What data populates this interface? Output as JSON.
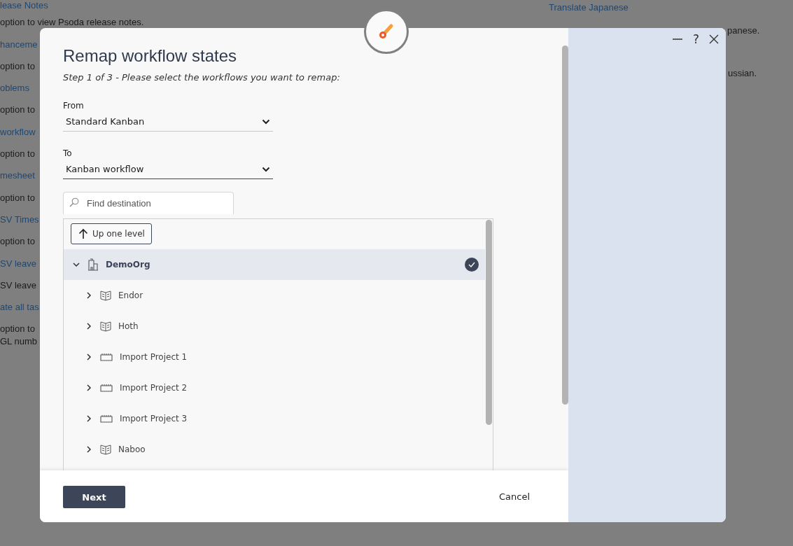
{
  "background": {
    "left_lines": [
      {
        "text": "lease Notes",
        "kind": "link"
      },
      {
        "text": "option to view Psoda release notes.",
        "kind": "text"
      },
      {
        "text": "hanceme",
        "kind": "link"
      },
      {
        "text": "option to",
        "kind": "text"
      },
      {
        "text": "oblems",
        "kind": "link"
      },
      {
        "text": "option to",
        "kind": "text"
      },
      {
        "text": "workflow",
        "kind": "link"
      },
      {
        "text": "option to",
        "kind": "text"
      },
      {
        "text": "mesheet",
        "kind": "link"
      },
      {
        "text": "option to",
        "kind": "text"
      },
      {
        "text": "SV Times",
        "kind": "link"
      },
      {
        "text": "option to",
        "kind": "text"
      },
      {
        "text": "SV leave",
        "kind": "link"
      },
      {
        "text": "SV leave",
        "kind": "text"
      },
      {
        "text": "ate all tas",
        "kind": "link"
      },
      {
        "text": "option to",
        "kind": "text"
      },
      {
        "text": "GL numb",
        "kind": "text"
      }
    ],
    "right_lines": [
      {
        "text": "Translate Japanese",
        "kind": "link"
      },
      {
        "text": "panese.",
        "kind": "text"
      },
      {
        "text": "ussian.",
        "kind": "text"
      }
    ]
  },
  "dialog": {
    "title": "Remap workflow states",
    "subtitle": "Step 1 of 3 - Please select the workflows you want to remap:",
    "from": {
      "label": "From",
      "value": "Standard Kanban",
      "focused": false
    },
    "to": {
      "label": "To",
      "value": "Kanban workflow",
      "focused": true
    },
    "search": {
      "placeholder": "Find destination"
    },
    "up_button": "Up one level",
    "tree": [
      {
        "label": "DemoOrg",
        "kind": "org",
        "expanded": true,
        "selected": true,
        "children": [
          {
            "label": "Endor",
            "kind": "book",
            "expanded": false,
            "selected": false
          },
          {
            "label": "Hoth",
            "kind": "book",
            "expanded": false,
            "selected": false
          },
          {
            "label": "Import Project 1",
            "kind": "project",
            "expanded": false,
            "selected": false
          },
          {
            "label": "Import Project 2",
            "kind": "project",
            "expanded": false,
            "selected": false
          },
          {
            "label": "Import Project 3",
            "kind": "project",
            "expanded": false,
            "selected": false
          },
          {
            "label": "Naboo",
            "kind": "book",
            "expanded": false,
            "selected": false
          }
        ]
      }
    ],
    "next_button": "Next",
    "cancel_button": "Cancel",
    "help_button": "?"
  }
}
